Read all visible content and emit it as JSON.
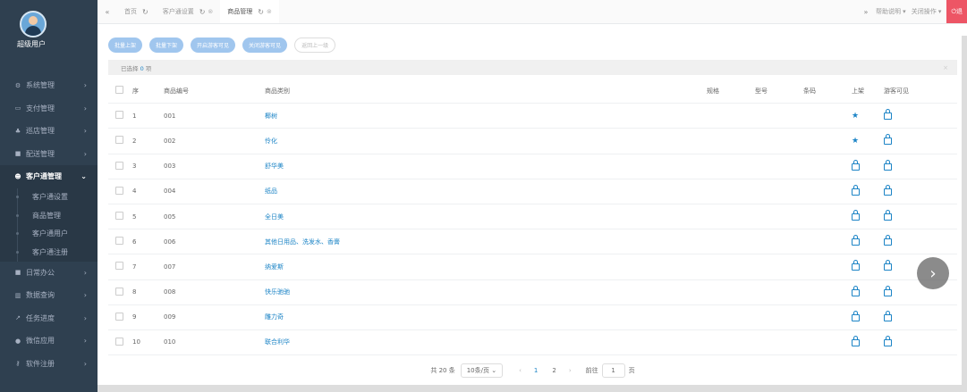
{
  "user": {
    "name": "超级用户"
  },
  "sidebar": {
    "items": [
      {
        "icon": "gears-icon",
        "glyph": "⚙",
        "label": "系统管理"
      },
      {
        "icon": "credit-card-icon",
        "glyph": "▭",
        "label": "支付管理"
      },
      {
        "icon": "sitemap-icon",
        "glyph": "♣",
        "label": "巡店管理"
      },
      {
        "icon": "truck-icon",
        "glyph": "■",
        "label": "配送管理"
      },
      {
        "icon": "users-icon",
        "glyph": "☻",
        "label": "客户通管理",
        "expanded": true,
        "arrow": "⌄"
      },
      {
        "icon": "briefcase-icon",
        "glyph": "■",
        "label": "日常办公"
      },
      {
        "icon": "bar-chart-icon",
        "glyph": "▥",
        "label": "数据查询"
      },
      {
        "icon": "line-chart-icon",
        "glyph": "↗",
        "label": "任务进度"
      },
      {
        "icon": "wechat-icon",
        "glyph": "●",
        "label": "微信应用"
      },
      {
        "icon": "key-icon",
        "glyph": "⚷",
        "label": "软件注册"
      }
    ],
    "arrow": "›",
    "subitems": [
      "客户通设置",
      "商品管理",
      "客户通用户",
      "客户通注册"
    ]
  },
  "tabbar": {
    "back": "«",
    "forward": "»",
    "tabs": [
      {
        "label": "首页",
        "refresh": "↻",
        "close": ""
      },
      {
        "label": "客户通设置",
        "refresh": "↻",
        "close": "⊗"
      },
      {
        "label": "商品管理",
        "refresh": "↻",
        "close": "⊗",
        "active": true
      }
    ],
    "help": "帮助说明 ▾",
    "close_ops": "关闭操作 ▾",
    "logout": "⏻退"
  },
  "toolbar": {
    "buttons": [
      "批量上架",
      "批量下架",
      "开启游客可见",
      "关闭游客可见"
    ],
    "back": "返回上一级"
  },
  "selection": {
    "prefix": "已选择",
    "count": "0",
    "suffix": "项",
    "close": "×"
  },
  "table": {
    "headers": [
      "序",
      "商品编号",
      "商品类别",
      "规格",
      "型号",
      "条码",
      "上架",
      "游客可见"
    ],
    "rows": [
      {
        "idx": "1",
        "code": "001",
        "category": "椰树",
        "on_shelf": true
      },
      {
        "idx": "2",
        "code": "002",
        "category": "伶化",
        "on_shelf": true
      },
      {
        "idx": "3",
        "code": "003",
        "category": "舒华美",
        "on_shelf": false
      },
      {
        "idx": "4",
        "code": "004",
        "category": "纸品",
        "on_shelf": false
      },
      {
        "idx": "5",
        "code": "005",
        "category": "全日美",
        "on_shelf": false
      },
      {
        "idx": "6",
        "code": "006",
        "category": "其他日用品、洗发水、香膏",
        "on_shelf": false
      },
      {
        "idx": "7",
        "code": "007",
        "category": "纳爱斯",
        "on_shelf": false
      },
      {
        "idx": "8",
        "code": "008",
        "category": "快乐驰驰",
        "on_shelf": false
      },
      {
        "idx": "9",
        "code": "009",
        "category": "雕力奇",
        "on_shelf": false
      },
      {
        "idx": "10",
        "code": "010",
        "category": "联合利华",
        "on_shelf": false
      }
    ]
  },
  "pager": {
    "total": "共 20 条",
    "page_size": "10条/页 ⌄",
    "prev": "‹",
    "pages": [
      "1",
      "2"
    ],
    "current": "1",
    "next": "›",
    "goto": "前往",
    "goto_value": "1",
    "page_unit": "页"
  },
  "carousel_next": "›"
}
